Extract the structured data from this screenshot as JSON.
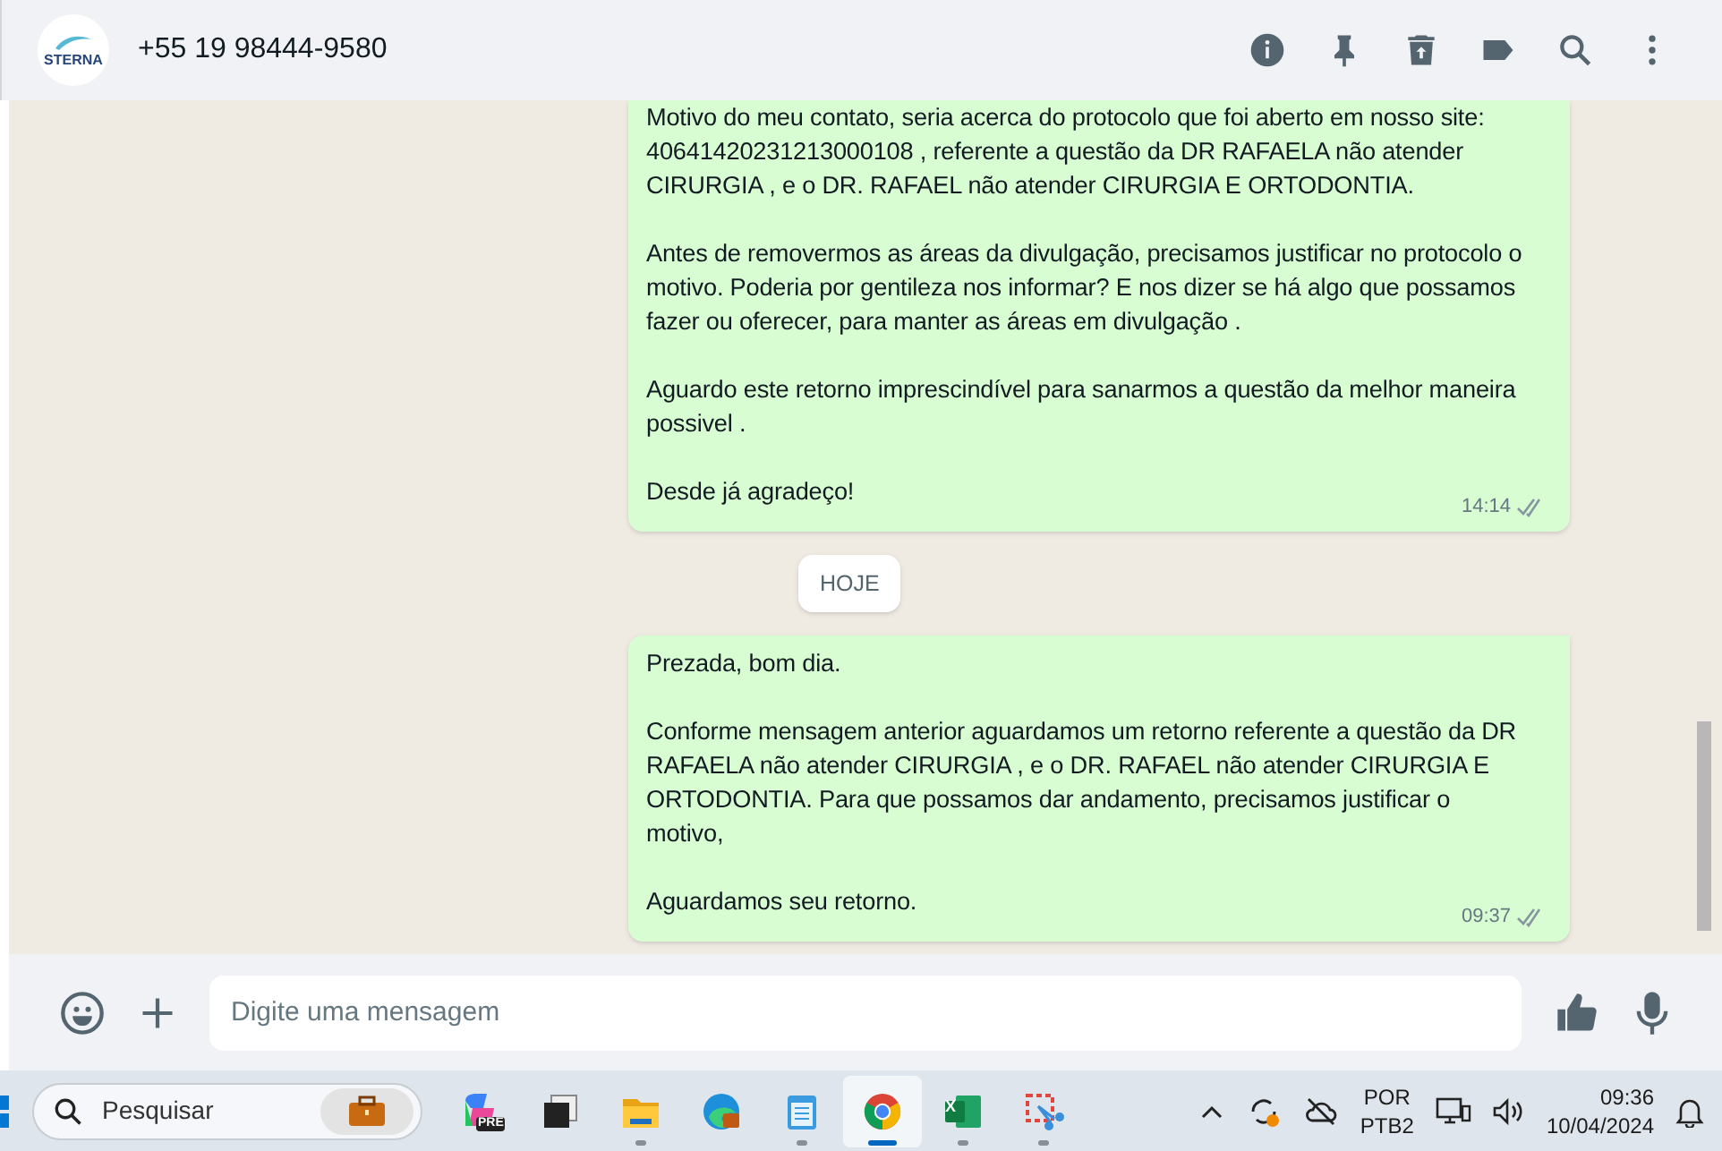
{
  "header": {
    "contact": "+55 19 98444-9580",
    "avatar_text": "STERNA"
  },
  "messages": [
    {
      "kind": "outgoing",
      "paragraphs": [
        "Motivo do meu contato, seria acerca do protocolo que foi aberto em nosso site: 40641420231213000108 , referente a questão da DR RAFAELA não atender CIRURGIA , e o DR. RAFAEL não atender CIRURGIA E ORTODONTIA.",
        "Antes de removermos as áreas da divulgação, precisamos justificar no protocolo o motivo. Poderia por gentileza nos informar? E nos dizer se há algo que possamos fazer ou oferecer, para manter as áreas em divulgação .",
        "Aguardo este retorno imprescindível para sanarmos a questão da melhor maneira possivel .",
        "Desde já agradeço!"
      ],
      "time": "14:14"
    },
    {
      "kind": "date",
      "label": "HOJE"
    },
    {
      "kind": "outgoing",
      "paragraphs": [
        "Prezada, bom dia.",
        "Conforme mensagem anterior aguardamos um retorno referente a questão da DR RAFAELA não atender CIRURGIA , e o DR. RAFAEL não atender CIRURGIA E ORTODONTIA.  Para que possamos dar andamento, precisamos justificar o motivo,",
        "Aguardamos seu retorno."
      ],
      "time": "09:37"
    }
  ],
  "composer": {
    "placeholder": "Digite uma mensagem"
  },
  "taskbar": {
    "search_placeholder": "Pesquisar",
    "apps": [
      {
        "kind": "copilot",
        "running": false,
        "selected": false,
        "badge": "PRE"
      },
      {
        "kind": "taskview",
        "running": false,
        "selected": false
      },
      {
        "kind": "explorer",
        "running": true,
        "selected": false
      },
      {
        "kind": "edge",
        "running": false,
        "selected": false
      },
      {
        "kind": "notepad",
        "running": true,
        "selected": false
      },
      {
        "kind": "chrome",
        "running": true,
        "selected": true
      },
      {
        "kind": "excel",
        "running": true,
        "selected": false,
        "badge": "X"
      },
      {
        "kind": "snipping",
        "running": true,
        "selected": false
      }
    ],
    "language": "POR",
    "layout": "PTB2",
    "time": "09:36",
    "date": "10/04/2024"
  }
}
